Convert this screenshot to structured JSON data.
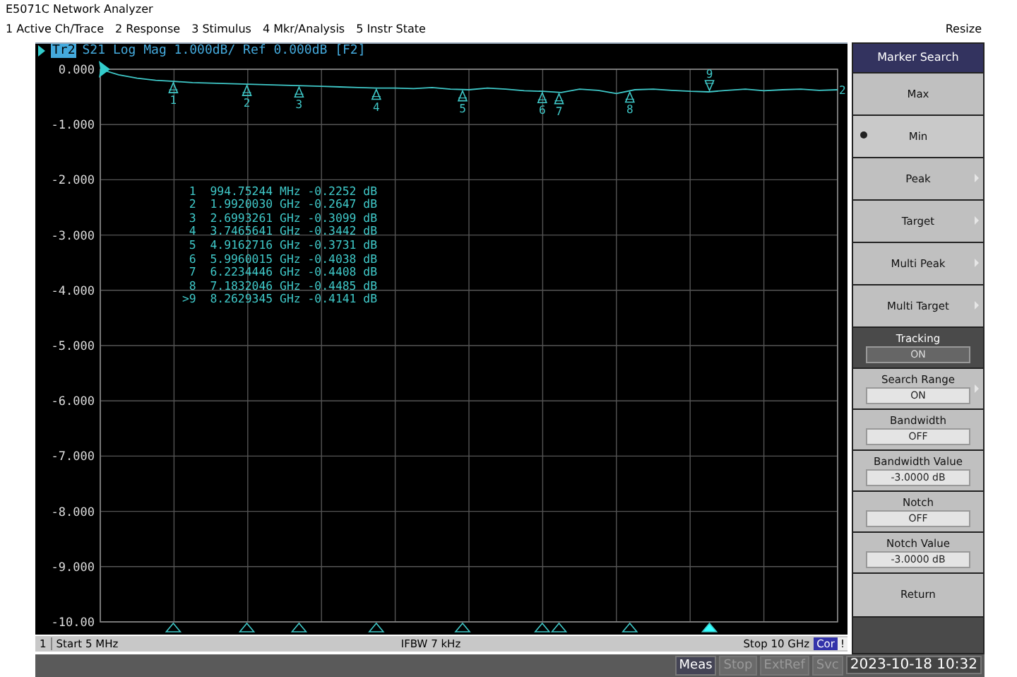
{
  "window": {
    "title": "E5071C Network Analyzer"
  },
  "menu": [
    "1 Active Ch/Trace",
    "2 Response",
    "3 Stimulus",
    "4 Mkr/Analysis",
    "5 Instr State"
  ],
  "resize": "Resize",
  "trace_header": {
    "trace": "Tr2",
    "text": "S21 Log Mag 1.000dB/ Ref 0.000dB [F2]",
    "end_label": "2"
  },
  "chart_data": {
    "type": "line",
    "grid": true,
    "ylim": [
      -10,
      0
    ],
    "yticks": [
      {
        "value": 0,
        "label": "0.000"
      },
      {
        "value": -1,
        "label": "-1.000"
      },
      {
        "value": -2,
        "label": "-2.000"
      },
      {
        "value": -3,
        "label": "-3.000"
      },
      {
        "value": -4,
        "label": "-4.000"
      },
      {
        "value": -5,
        "label": "-5.000"
      },
      {
        "value": -6,
        "label": "-6.000"
      },
      {
        "value": -7,
        "label": "-7.000"
      },
      {
        "value": -8,
        "label": "-8.000"
      },
      {
        "value": -9,
        "label": "-9.000"
      },
      {
        "value": -10,
        "label": "-10.00"
      }
    ],
    "categories": [
      null,
      null,
      null,
      null,
      null,
      null,
      null,
      null,
      null,
      null,
      null,
      null,
      null,
      null,
      null,
      null,
      null,
      null,
      null,
      null,
      null,
      null,
      null,
      null,
      null,
      null,
      null,
      null,
      null,
      null,
      null,
      null,
      null,
      null,
      null,
      null,
      null,
      null,
      null,
      null,
      null
    ],
    "series": [
      {
        "color": "#3fc8c8",
        "values": [
          0,
          -0.1,
          -0.16,
          -0.2,
          -0.22,
          -0.24,
          -0.25,
          -0.26,
          -0.27,
          -0.28,
          -0.29,
          -0.3,
          -0.31,
          -0.32,
          -0.33,
          -0.34,
          -0.34,
          -0.35,
          -0.33,
          -0.36,
          -0.37,
          -0.34,
          -0.36,
          -0.39,
          -0.4,
          -0.42,
          -0.36,
          -0.38,
          -0.44,
          -0.37,
          -0.36,
          -0.38,
          -0.4,
          -0.41,
          -0.38,
          -0.36,
          -0.39,
          -0.37,
          -0.36,
          -0.38,
          -0.37
        ]
      }
    ]
  },
  "markers": [
    {
      "label": "1",
      "table_label": "1",
      "freq": "994.75244 MHz",
      "value": "-0.2252 dB",
      "active": false
    },
    {
      "label": "2",
      "table_label": "2",
      "freq": "1.9920030 GHz",
      "value": "-0.2647 dB",
      "active": false
    },
    {
      "label": "3",
      "table_label": "3",
      "freq": "2.6993261 GHz",
      "value": "-0.3099 dB",
      "active": false
    },
    {
      "label": "4",
      "table_label": "4",
      "freq": "3.7465641 GHz",
      "value": "-0.3442 dB",
      "active": false
    },
    {
      "label": "5",
      "table_label": "5",
      "freq": "4.9162716 GHz",
      "value": "-0.3731 dB",
      "active": false
    },
    {
      "label": "6",
      "table_label": "6",
      "freq": "5.9960015 GHz",
      "value": "-0.4038 dB",
      "active": false
    },
    {
      "label": "7",
      "table_label": "7",
      "freq": "6.2234446 GHz",
      "value": "-0.4408 dB",
      "active": false
    },
    {
      "label": "8",
      "table_label": "8",
      "freq": "7.1832046 GHz",
      "value": "-0.4485 dB",
      "active": false
    },
    {
      "label": "9",
      "table_label": "9",
      "freq": "8.2629345 GHz",
      "value": "-0.4141 dB",
      "active": true
    }
  ],
  "marker_table_active_prefix": ">",
  "softkeys": [
    {
      "kind": "header",
      "label": "Marker Search"
    },
    {
      "kind": "button",
      "label": "Max",
      "selected": false,
      "submenu": false
    },
    {
      "kind": "button",
      "label": "Min",
      "selected": true,
      "submenu": false
    },
    {
      "kind": "button",
      "label": "Peak",
      "selected": false,
      "submenu": true
    },
    {
      "kind": "button",
      "label": "Target",
      "selected": false,
      "submenu": true
    },
    {
      "kind": "button",
      "label": "Multi Peak",
      "selected": false,
      "submenu": true
    },
    {
      "kind": "button",
      "label": "Multi Target",
      "selected": false,
      "submenu": true
    },
    {
      "kind": "value",
      "label": "Tracking",
      "value": "ON",
      "highlighted": true,
      "submenu": false
    },
    {
      "kind": "value",
      "label": "Search Range",
      "value": "ON",
      "highlighted": false,
      "submenu": true
    },
    {
      "kind": "value",
      "label": "Bandwidth",
      "value": "OFF",
      "highlighted": false,
      "submenu": false
    },
    {
      "kind": "value",
      "label": "Bandwidth Value",
      "value": "-3.0000 dB",
      "highlighted": false,
      "submenu": false
    },
    {
      "kind": "value",
      "label": "Notch",
      "value": "OFF",
      "highlighted": false,
      "submenu": false
    },
    {
      "kind": "value",
      "label": "Notch Value",
      "value": "-3.0000 dB",
      "highlighted": false,
      "submenu": false
    },
    {
      "kind": "button",
      "label": "Return",
      "selected": false,
      "submenu": false
    }
  ],
  "channel_bar": {
    "channel": "1",
    "start": "Start 5 MHz",
    "ifbw": "IFBW 7 kHz",
    "stop": "Stop 10 GHz",
    "cor": "Cor",
    "warning": "!"
  },
  "status_bar": {
    "indicators": [
      {
        "label": "Meas",
        "on": true
      },
      {
        "label": "Stop",
        "on": false
      },
      {
        "label": "ExtRef",
        "on": false
      },
      {
        "label": "Svc",
        "on": false
      }
    ],
    "datetime": "2023-10-18 10:32"
  }
}
